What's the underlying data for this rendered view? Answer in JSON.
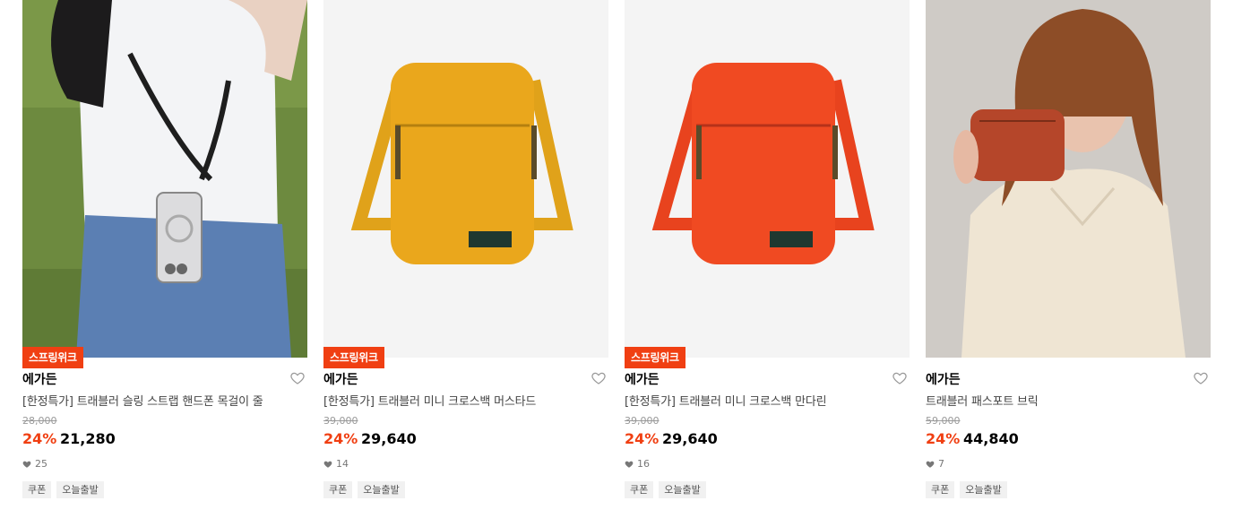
{
  "products": [
    {
      "badge": "스프링위크",
      "brand": "에가든",
      "name": "[한정특가] 트래블러 슬링 스트랩 핸드폰 목걸이 줄",
      "original_price": "28,000",
      "discount": "24%",
      "price": "21,280",
      "likes": "25",
      "tags": [
        "쿠폰",
        "오늘출발"
      ],
      "image_desc": "person-with-phone-strap"
    },
    {
      "badge": "스프링위크",
      "brand": "에가든",
      "name": "[한정특가] 트래블러 미니 크로스백 머스타드",
      "original_price": "39,000",
      "discount": "24%",
      "price": "29,640",
      "likes": "14",
      "tags": [
        "쿠폰",
        "오늘출발"
      ],
      "bag_color": "#eaa71c"
    },
    {
      "badge": "스프링위크",
      "brand": "에가든",
      "name": "[한정특가] 트래블러 미니 크로스백 만다린",
      "original_price": "39,000",
      "discount": "24%",
      "price": "29,640",
      "likes": "16",
      "tags": [
        "쿠폰",
        "오늘출발"
      ],
      "bag_color": "#f04a22"
    },
    {
      "badge": "",
      "brand": "에가든",
      "name": "트래블러 패스포트 브릭",
      "original_price": "59,000",
      "discount": "24%",
      "price": "44,840",
      "likes": "7",
      "tags": [
        "쿠폰",
        "오늘출발"
      ],
      "bag_color": "#b5462a"
    }
  ],
  "colors": {
    "accent": "#f03f12"
  }
}
